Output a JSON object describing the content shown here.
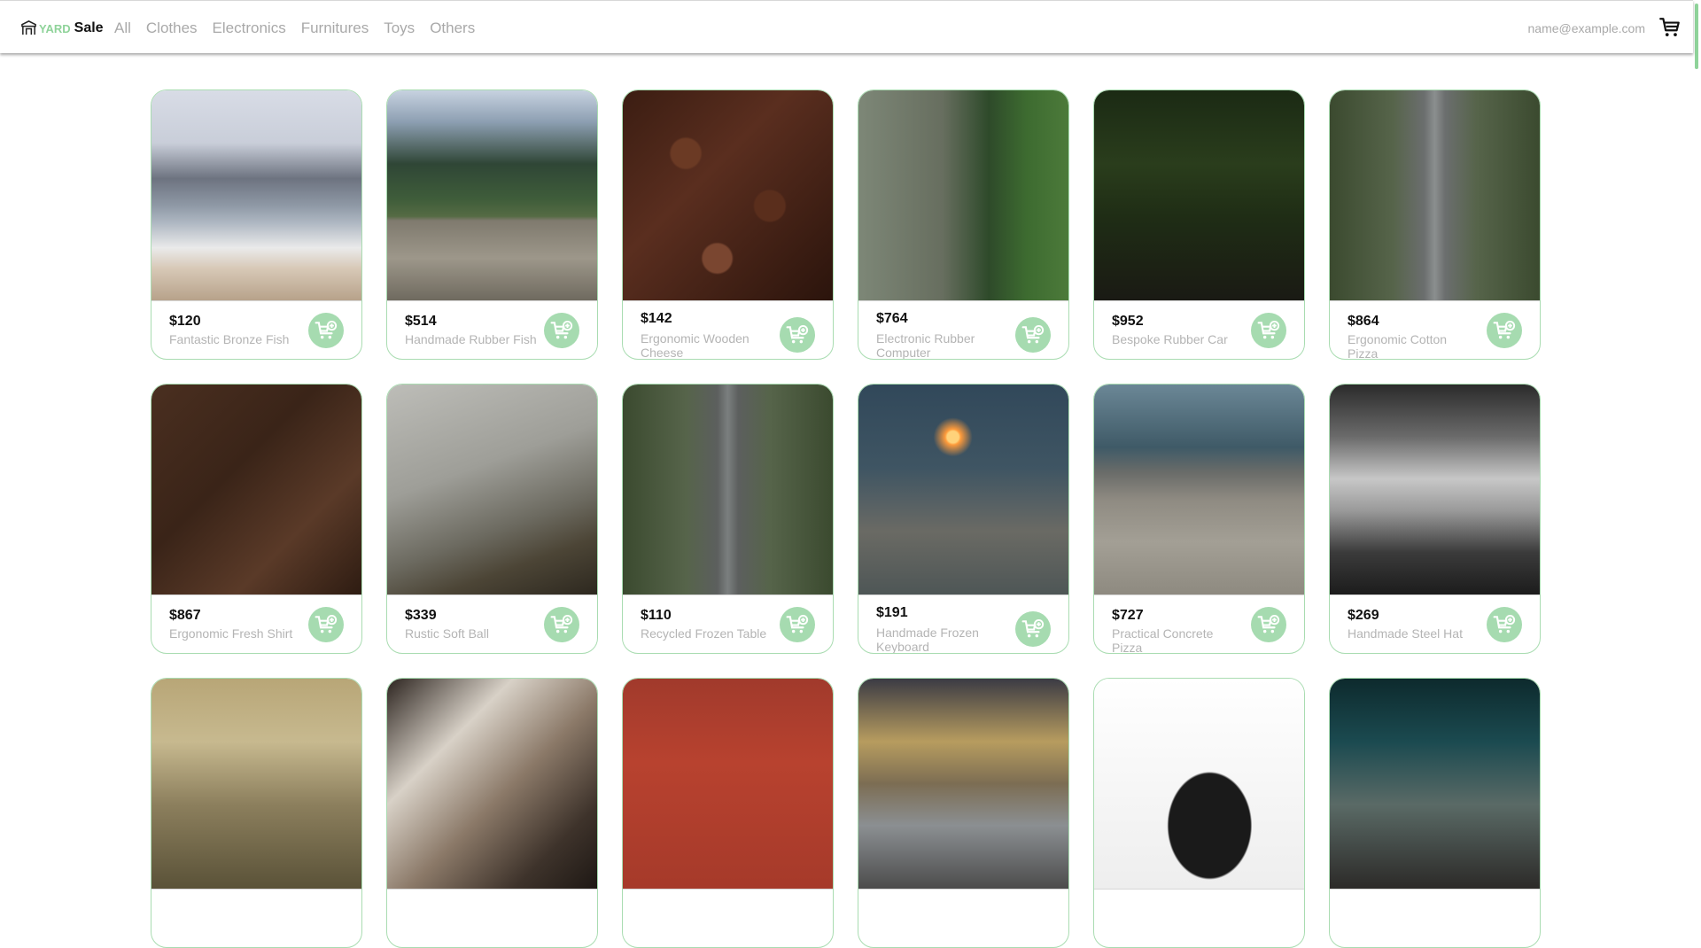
{
  "header": {
    "logo_yard": "YARD",
    "logo_sale": "Sale",
    "nav": [
      "All",
      "Clothes",
      "Electronics",
      "Furnitures",
      "Toys",
      "Others"
    ],
    "email": "name@example.com",
    "cart_icon": "shopping-cart-icon"
  },
  "colors": {
    "accent": "#a6dbb0",
    "logo_green": "#8fd39a",
    "muted_text": "#a9a9a9"
  },
  "products": [
    {
      "price": "$120",
      "name": "Fantastic Bronze Fish"
    },
    {
      "price": "$514",
      "name": "Handmade Rubber Fish"
    },
    {
      "price": "$142",
      "name": "Ergonomic Wooden Cheese"
    },
    {
      "price": "$764",
      "name": "Electronic Rubber Computer"
    },
    {
      "price": "$952",
      "name": "Bespoke Rubber Car"
    },
    {
      "price": "$864",
      "name": "Ergonomic Cotton Pizza"
    },
    {
      "price": "$867",
      "name": "Ergonomic Fresh Shirt"
    },
    {
      "price": "$339",
      "name": "Rustic Soft Ball"
    },
    {
      "price": "$110",
      "name": "Recycled Frozen Table"
    },
    {
      "price": "$191",
      "name": "Handmade Frozen Keyboard"
    },
    {
      "price": "$727",
      "name": "Practical Concrete Pizza"
    },
    {
      "price": "$269",
      "name": "Handmade Steel Hat"
    },
    {
      "price": "",
      "name": ""
    },
    {
      "price": "",
      "name": ""
    },
    {
      "price": "",
      "name": ""
    },
    {
      "price": "",
      "name": ""
    },
    {
      "price": "",
      "name": ""
    },
    {
      "price": "",
      "name": ""
    }
  ]
}
